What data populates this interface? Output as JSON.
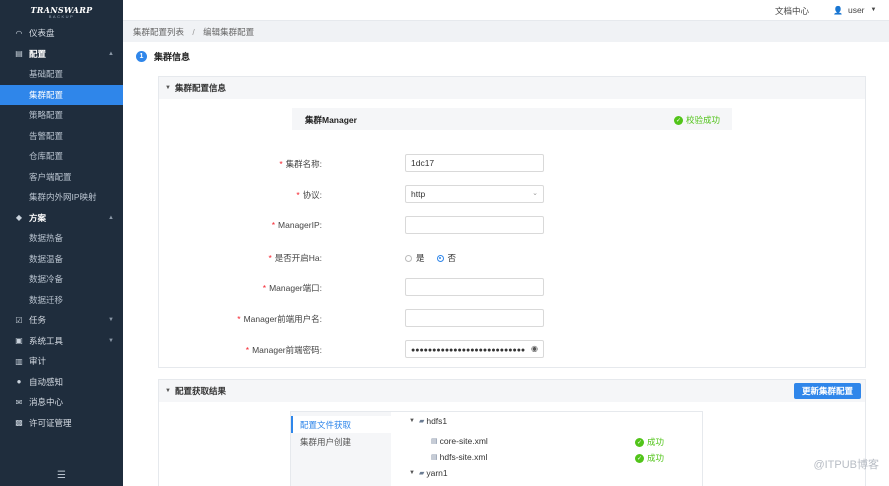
{
  "sidebar": {
    "logo": "TRANSWARP",
    "logo_sub": "BACKUP",
    "items": [
      {
        "label": "仪表盘",
        "icon": "dashboard-icon",
        "glyph": "◠"
      },
      {
        "label": "配置",
        "icon": "config-icon",
        "glyph": "▤"
      },
      {
        "label": "基础配置"
      },
      {
        "label": "集群配置"
      },
      {
        "label": "策略配置"
      },
      {
        "label": "告警配置"
      },
      {
        "label": "仓库配置"
      },
      {
        "label": "客户端配置"
      },
      {
        "label": "集群内外网IP映射"
      },
      {
        "label": "方案",
        "icon": "cube-icon",
        "glyph": "◆"
      },
      {
        "label": "数据热备"
      },
      {
        "label": "数据温备"
      },
      {
        "label": "数据冷备"
      },
      {
        "label": "数据迁移"
      },
      {
        "label": "任务",
        "icon": "task-icon",
        "glyph": "☑"
      },
      {
        "label": "系统工具",
        "icon": "tools-icon",
        "glyph": "▣"
      },
      {
        "label": "审计",
        "icon": "audit-icon",
        "glyph": "▥"
      },
      {
        "label": "自动感知",
        "icon": "sense-icon",
        "glyph": "●"
      },
      {
        "label": "消息中心",
        "icon": "message-icon",
        "glyph": "✉"
      },
      {
        "label": "许可证管理",
        "icon": "license-icon",
        "glyph": "▩"
      }
    ],
    "toggle": "☰"
  },
  "header": {
    "doc_center": "文档中心",
    "user": "user"
  },
  "breadcrumb": {
    "first": "集群配置列表",
    "sep": "/",
    "second": "编辑集群配置"
  },
  "step": {
    "num": "1",
    "title": "集群信息"
  },
  "cluster_panel": {
    "title": "集群配置信息",
    "manager_title": "集群Manager",
    "verify_status": "校验成功",
    "fields": {
      "name_label": "集群名称:",
      "name_value": "1dc17",
      "protocol_label": "协议:",
      "protocol_value": "http",
      "ip_label": "ManagerIP:",
      "ip_value": "",
      "ha_label": "是否开启Ha:",
      "ha_yes": "是",
      "ha_no": "否",
      "ha_selected": "否",
      "port_label": "Manager端口:",
      "port_value": "",
      "username_label": "Manager前端用户名:",
      "username_value": "",
      "password_label": "Manager前端密码:",
      "password_mask": "●●●●●●●●●●●●●●●●●●●●●●●●●●●"
    }
  },
  "result_panel": {
    "title": "配置获取结果",
    "update_button": "更新集群配置",
    "tabs": [
      "配置文件获取",
      "集群用户创建"
    ],
    "tree": {
      "hdfs": "hdfs1",
      "core": "core-site.xml",
      "hdfs_site": "hdfs-site.xml",
      "yarn": "yarn1",
      "status_ok": "成功"
    }
  },
  "watermark": "@ITPUB博客"
}
